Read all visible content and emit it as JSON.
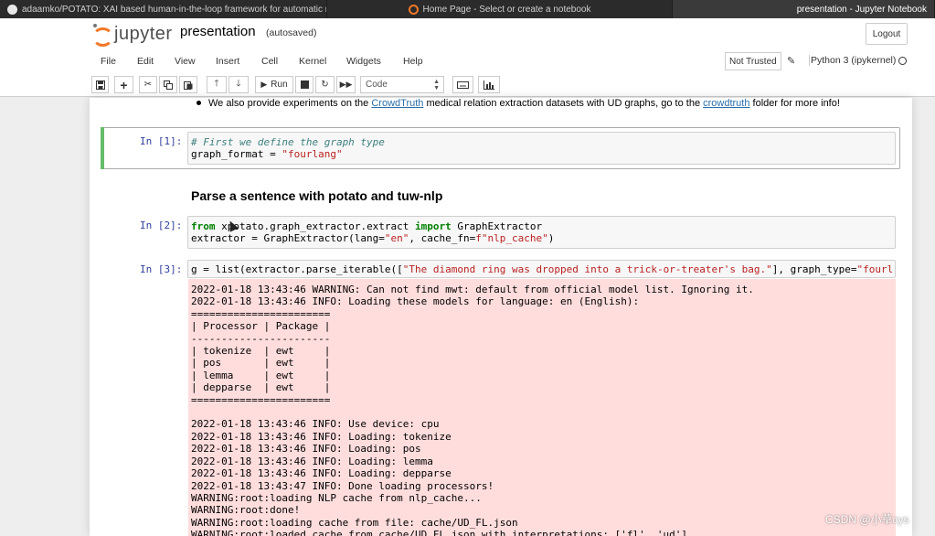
{
  "browser_tabs": [
    {
      "label": "adaamko/POTATO: XAI based human-in-the-loop framework for automatic rule...",
      "icon": "github-icon"
    },
    {
      "label": "Home Page - Select or create a notebook",
      "icon": "jupyter-icon"
    },
    {
      "label": "presentation - Jupyter Notebook",
      "icon": ""
    }
  ],
  "header": {
    "logo_text": "jupyter",
    "notebook_title": "presentation",
    "save_status": "(autosaved)",
    "logout_label": "Logout"
  },
  "menu": {
    "items": [
      "File",
      "Edit",
      "View",
      "Insert",
      "Cell",
      "Kernel",
      "Widgets",
      "Help"
    ],
    "trust_label": "Not Trusted",
    "kernel_name": "Python 3 (ipykernel)"
  },
  "toolbar": {
    "run_label": "Run",
    "cell_type": "Code"
  },
  "cells": {
    "md_bullet": {
      "prefix": "We also provide experiments on the ",
      "link1": "CrowdTruth",
      "middle": " medical relation extraction datasets with UD graphs, go to the ",
      "link2": "crowdtruth",
      "suffix": " folder for more info!"
    },
    "cell1": {
      "prompt": "In [1]:",
      "comment": "# First we define the graph type",
      "code_line2_a": "graph_format = ",
      "code_line2_str": "\"fourlang\""
    },
    "heading": "Parse a sentence with potato and tuw-nlp",
    "cell2": {
      "prompt": "In [2]:",
      "kw_from": "from",
      "module": " xpotato.graph_extractor.extract ",
      "kw_import": "import",
      "imported": " GraphExtractor",
      "line2_a": "extractor = GraphExtractor(lang=",
      "line2_str1": "\"en\"",
      "line2_b": ", cache_fn=",
      "line2_str2": "f\"nlp_cache\"",
      "line2_c": ")"
    },
    "cell3": {
      "prompt": "In [3]:",
      "code_a": "g = list(extractor.parse_iterable([",
      "code_str": "\"The diamond ring was dropped into a trick-or-treater's bag.\"",
      "code_b": "], graph_type=",
      "code_str2": "\"fourl",
      "output_lines": [
        "2022-01-18 13:43:46 WARNING: Can not find mwt: default from official model list. Ignoring it.",
        "2022-01-18 13:43:46 INFO: Loading these models for language: en (English):",
        "=======================",
        "| Processor | Package |",
        "-----------------------",
        "| tokenize  | ewt     |",
        "| pos       | ewt     |",
        "| lemma     | ewt     |",
        "| depparse  | ewt     |",
        "=======================",
        "",
        "2022-01-18 13:43:46 INFO: Use device: cpu",
        "2022-01-18 13:43:46 INFO: Loading: tokenize",
        "2022-01-18 13:43:46 INFO: Loading: pos",
        "2022-01-18 13:43:46 INFO: Loading: lemma",
        "2022-01-18 13:43:46 INFO: Loading: depparse",
        "2022-01-18 13:43:47 INFO: Done loading processors!",
        "WARNING:root:loading NLP cache from nlp_cache...",
        "WARNING:root:done!",
        "WARNING:root:loading cache from file: cache/UD_FL.json",
        "WARNING:root:loaded cache from cache/UD_FL.json with interpretations: ['fl', 'ud']"
      ]
    }
  },
  "watermark": "CSDN @小草cys"
}
